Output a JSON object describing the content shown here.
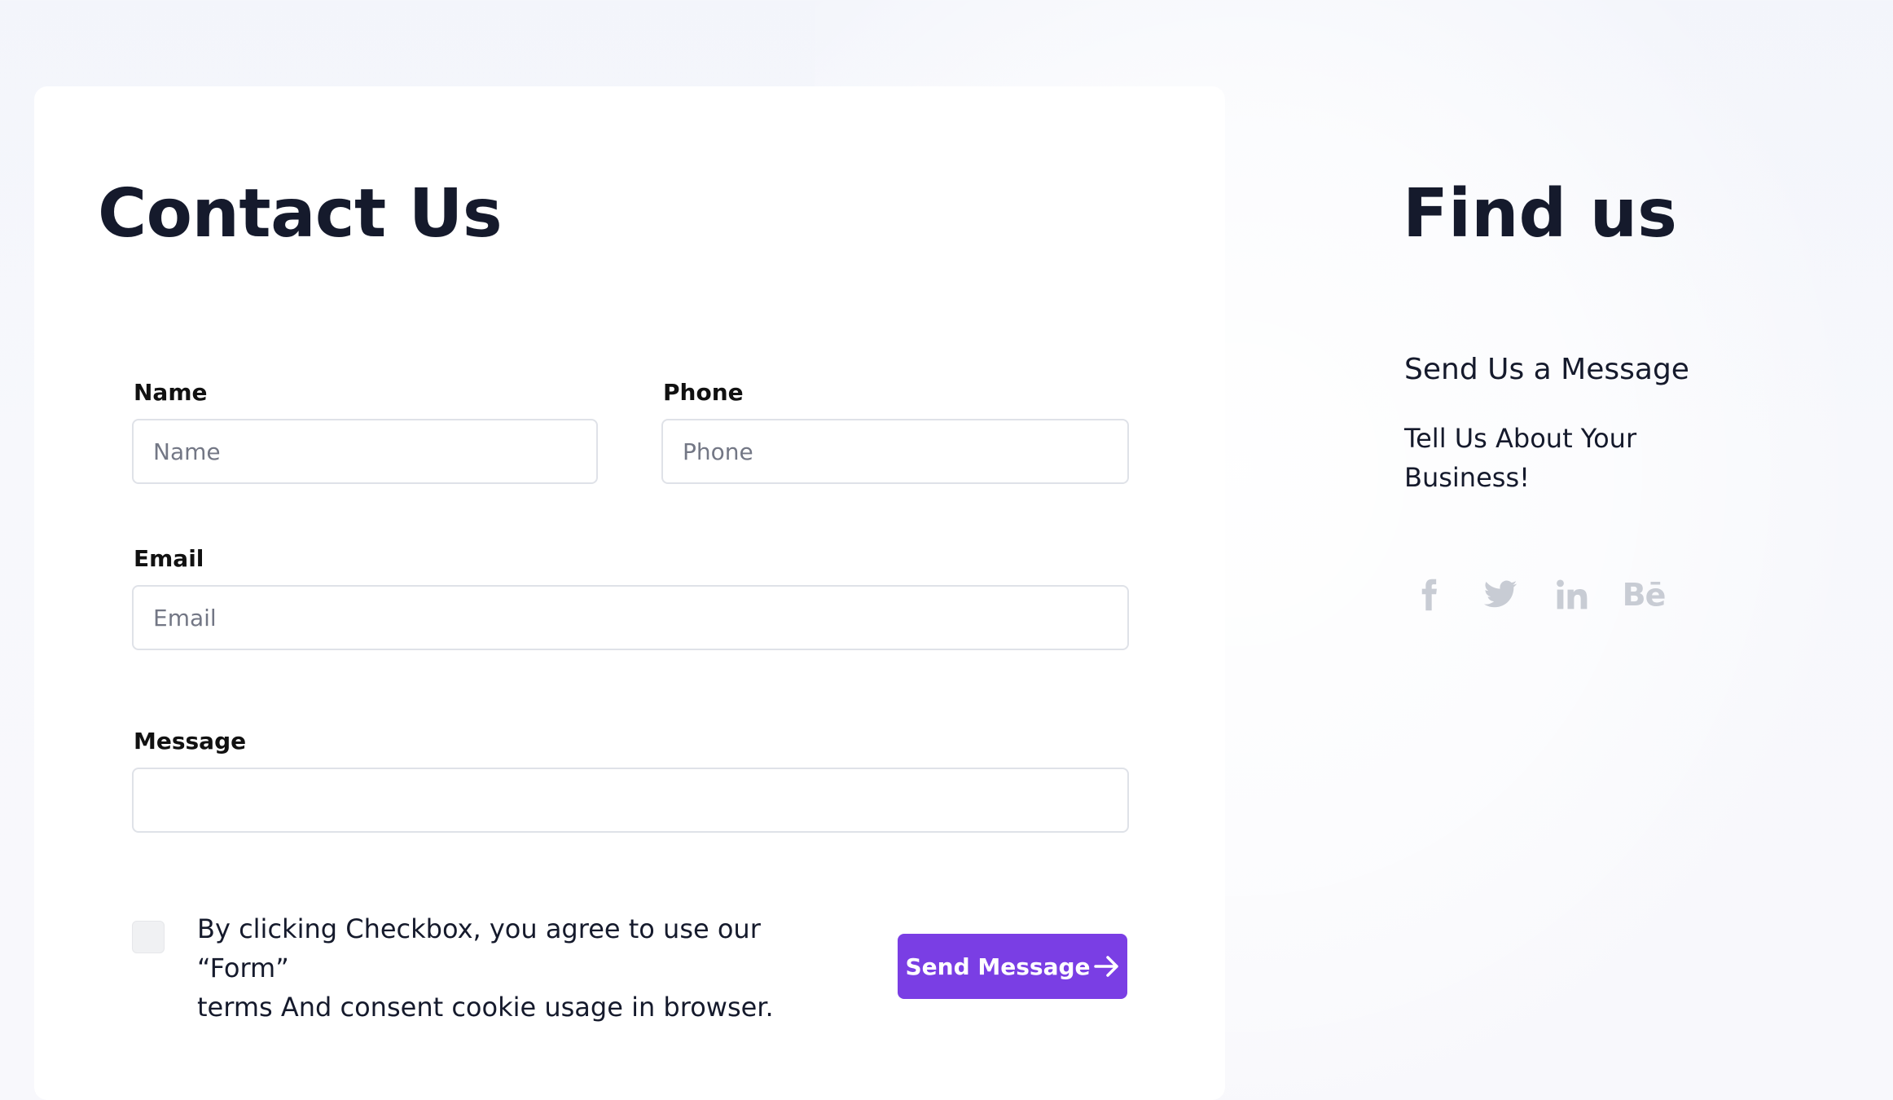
{
  "contact": {
    "title": "Contact Us",
    "name_label": "Name",
    "name_placeholder": "Name",
    "phone_label": "Phone",
    "phone_placeholder": "Phone",
    "email_label": "Email",
    "email_placeholder": "Email",
    "message_label": "Message",
    "message_value": "",
    "consent_line1": "By clicking Checkbox, you agree to use our “Form”",
    "consent_line2": "terms And consent cookie usage in browser.",
    "consent_checked": false,
    "send_label": "Send Message"
  },
  "find": {
    "title": "Find us",
    "subtitle": "Send Us a Message",
    "text_line1": "Tell Us About Your",
    "text_line2": "Business!",
    "social": [
      {
        "icon": "facebook-icon"
      },
      {
        "icon": "twitter-icon"
      },
      {
        "icon": "linkedin-icon"
      },
      {
        "icon": "behance-icon",
        "text": "Bē"
      }
    ]
  },
  "colors": {
    "accent": "#7a3ee4",
    "heading": "#151a2c",
    "social_icon": "#c8ccd4",
    "background": "#f5f6fb"
  }
}
